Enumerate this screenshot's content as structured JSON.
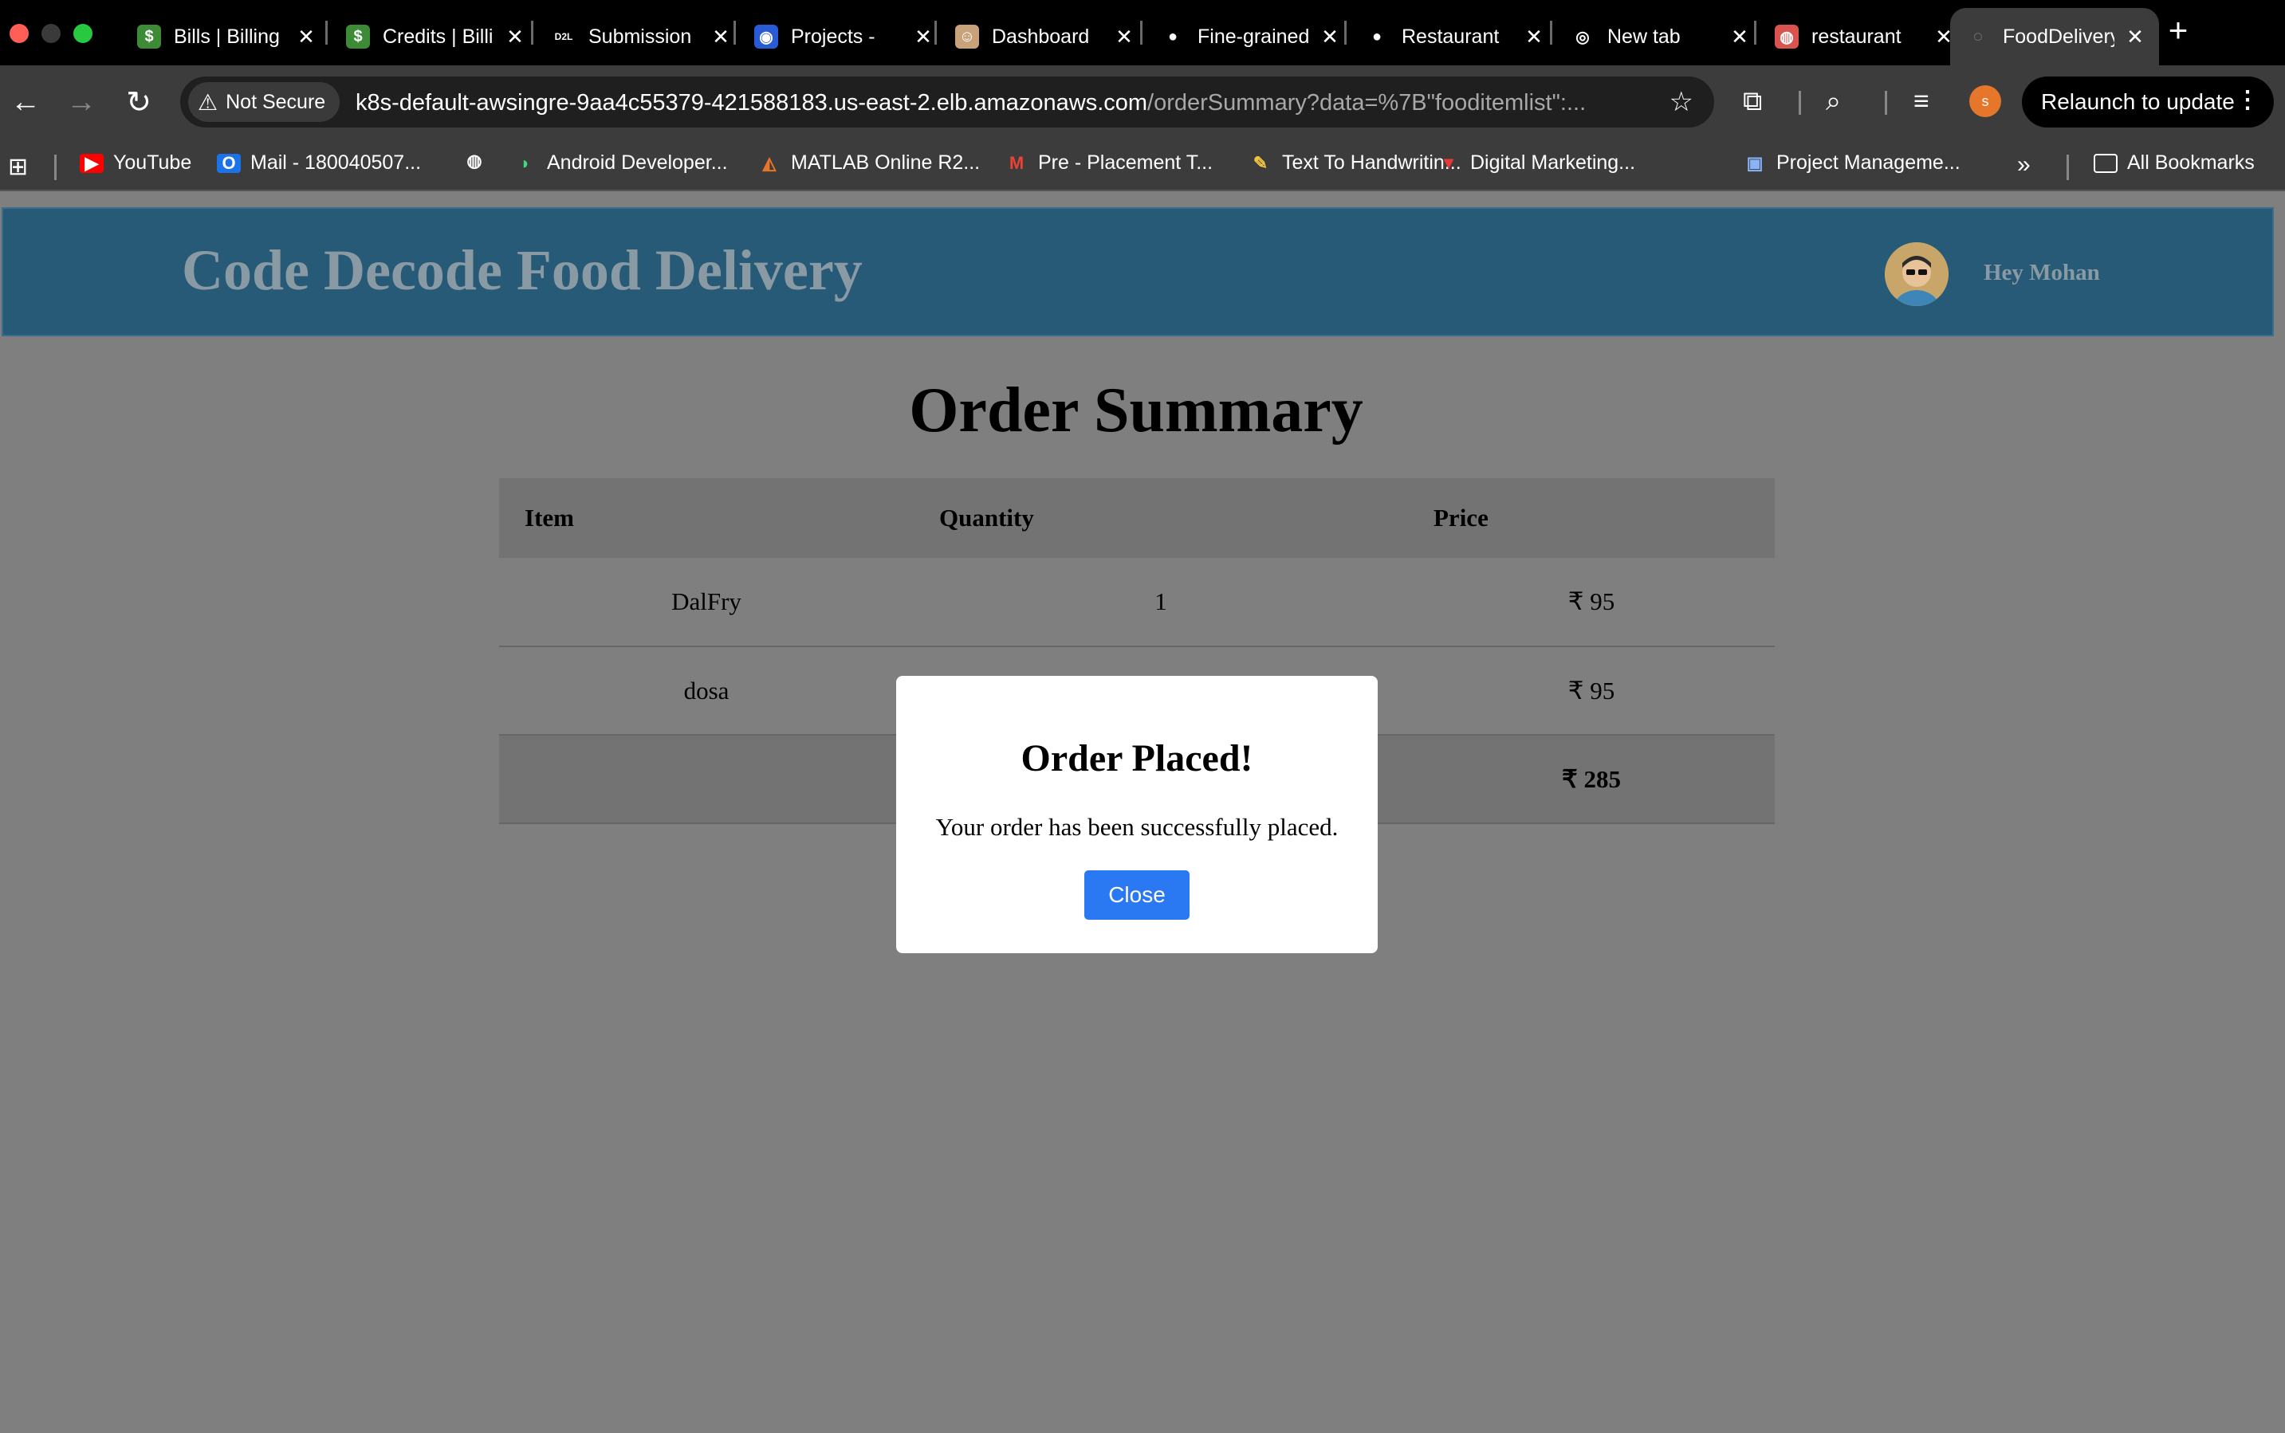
{
  "browser": {
    "tabs": [
      {
        "title": "Bills | Billing",
        "icon": "aws-billing-icon",
        "color": "#3d8b37"
      },
      {
        "title": "Credits | Billing",
        "icon": "aws-billing-icon",
        "color": "#3d8b37"
      },
      {
        "title": "Submission",
        "icon": "d2l-icon",
        "color": "#000000"
      },
      {
        "title": "Projects - ",
        "icon": "projects-icon",
        "color": "#2a5bd7"
      },
      {
        "title": "Dashboard",
        "icon": "jenkins-icon",
        "color": "#c9a27a"
      },
      {
        "title": "Fine-grained",
        "icon": "github-icon",
        "color": "#ffffff"
      },
      {
        "title": "Restaurant",
        "icon": "github-icon",
        "color": "#ffffff"
      },
      {
        "title": "New tab",
        "icon": "chrome-icon",
        "color": "#ffffff"
      },
      {
        "title": "restaurant",
        "icon": "restaurant-icon",
        "color": "#d9534f"
      },
      {
        "title": "FoodDelivery",
        "icon": "globe-icon",
        "color": "#9aa0a6",
        "active": true
      }
    ],
    "security_label": "Not Secure",
    "url_host": "k8s-default-awsingre-9aa4c55379-421588183.us-east-2.elb.amazonaws.com",
    "url_path": "/orderSummary?data=%7B\"fooditemlist\":...",
    "relaunch_label": "Relaunch to update",
    "profile_initial": "s",
    "bookmarks": [
      {
        "label": "YouTube",
        "icon": "youtube-icon",
        "color": "#ff0000"
      },
      {
        "label": "Mail - 180040507...",
        "icon": "outlook-icon",
        "color": "#1a73e8"
      },
      {
        "label": "",
        "icon": "globe-icon",
        "color": "#ffffff"
      },
      {
        "label": "Android Developer...",
        "icon": "android-icon",
        "color": "#3ddc84"
      },
      {
        "label": "MATLAB Online R2...",
        "icon": "matlab-icon",
        "color": "#e8742a"
      },
      {
        "label": "Pre - Placement T...",
        "icon": "gmail-icon",
        "color": "#ea4335"
      },
      {
        "label": "Text To Handwritin...",
        "icon": "notepad-icon",
        "color": "#f4c542"
      },
      {
        "label": "Digital Marketing...",
        "icon": "marketing-icon",
        "color": "#e53935"
      },
      {
        "label": "Project Manageme...",
        "icon": "project-icon",
        "color": "#8ab4f8"
      }
    ],
    "more_bookmarks": "»",
    "all_bookmarks_label": "All Bookmarks"
  },
  "header": {
    "brand": "Code Decode Food Delivery",
    "greeting": "Hey Mohan"
  },
  "page": {
    "title": "Order Summary"
  },
  "order_table": {
    "columns": [
      "Item",
      "Quantity",
      "Price"
    ],
    "rows": [
      {
        "item": "DalFry",
        "quantity": "1",
        "price": "₹ 95"
      },
      {
        "item": "dosa",
        "quantity": "",
        "price": "₹ 95"
      }
    ],
    "total": "₹ 285"
  },
  "modal": {
    "title": "Order Placed!",
    "message": "Your order has been successfully placed.",
    "close_label": "Close"
  }
}
